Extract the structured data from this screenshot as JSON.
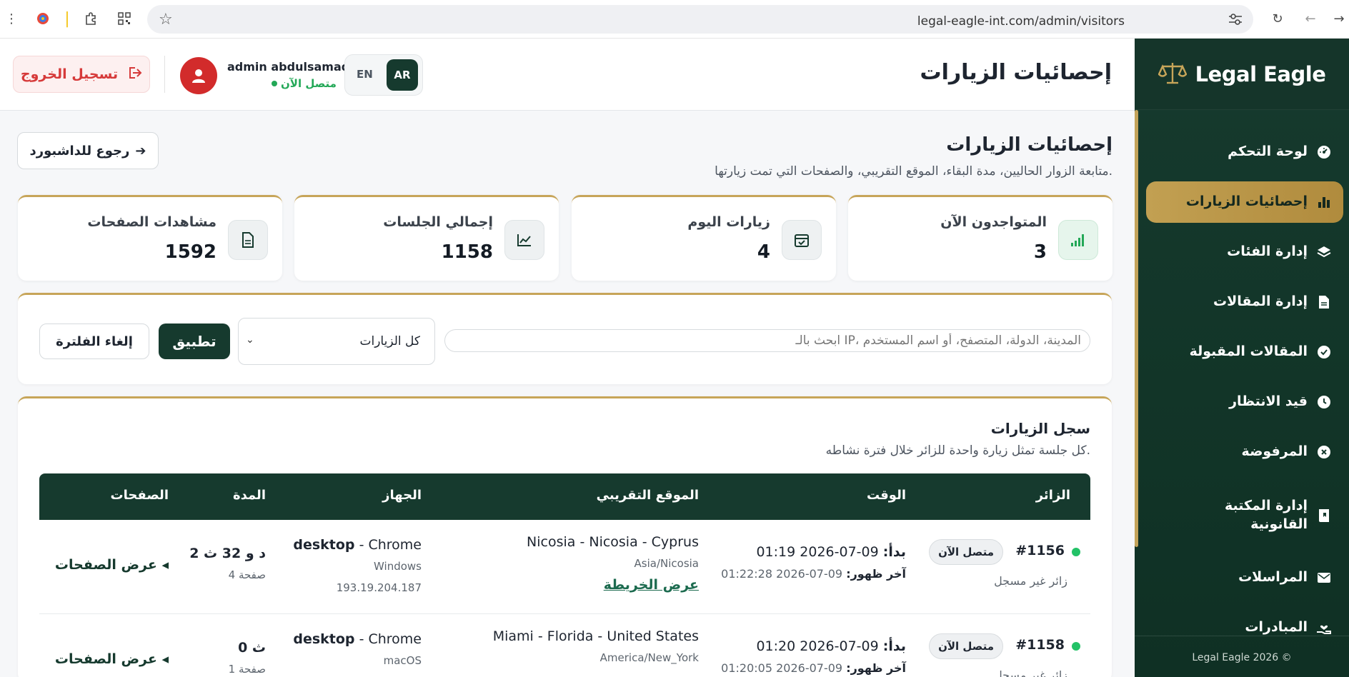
{
  "browser": {
    "url": "legal-eagle-int.com/admin/visitors"
  },
  "sidebar": {
    "brand": "Legal Eagle",
    "items": [
      {
        "label": "لوحة التحكم",
        "icon": "dashboard-gauge-icon"
      },
      {
        "label": "إحصائيات الزيارات",
        "icon": "bar-chart-icon",
        "active": true
      },
      {
        "label": "إدارة الفئات",
        "icon": "layers-icon"
      },
      {
        "label": "إدارة المقالات",
        "icon": "document-icon"
      },
      {
        "label": "المقالات المقبولة",
        "icon": "check-circle-icon"
      },
      {
        "label": "قيد الانتظار",
        "icon": "clock-icon"
      },
      {
        "label": "المرفوضة",
        "icon": "x-circle-icon"
      },
      {
        "label": "إدارة المكتبة القانونية",
        "icon": "book-icon"
      },
      {
        "label": "المراسلات",
        "icon": "envelope-icon"
      },
      {
        "label": "المبادرات",
        "icon": "hand-heart-icon"
      }
    ],
    "footer": "Legal Eagle 2026 ©"
  },
  "topbar": {
    "title": "إحصائيات الزيارات",
    "logout_label": "تسجيل الخروج",
    "admin_name": "admin abdulsamad",
    "admin_status": "متصل الآن",
    "lang_ar": "AR",
    "lang_en": "EN"
  },
  "header": {
    "title": "إحصائيات الزيارات",
    "subtitle": "متابعة الزوار الحاليين، مدة البقاء، الموقع التقريبي، والصفحات التي تمت زيارتها.",
    "back_label": "رجوع للداشبورد"
  },
  "stats": [
    {
      "label": "المتواجدون الآن",
      "value": "3",
      "icon": "signal-bars-icon"
    },
    {
      "label": "زيارات اليوم",
      "value": "4",
      "icon": "calendar-check-icon"
    },
    {
      "label": "إجمالي الجلسات",
      "value": "1158",
      "icon": "line-chart-icon"
    },
    {
      "label": "مشاهدات الصفحات",
      "value": "1592",
      "icon": "file-lines-icon"
    }
  ],
  "filters": {
    "search_placeholder": "ابحث بالـ IP، المدينة، الدولة، المتصفح، أو اسم المستخدم",
    "select_value": "كل الزيارات",
    "apply_label": "تطبيق",
    "clear_label": "إلغاء الفلترة"
  },
  "log": {
    "title": "سجل الزيارات",
    "subtitle": "كل جلسة تمثل زيارة واحدة للزائر خلال فترة نشاطه.",
    "columns": [
      "الزائر",
      "الوقت",
      "الموقع التقريبي",
      "الجهاز",
      "المدة",
      "الصفحات"
    ],
    "rows": [
      {
        "id": "#1156",
        "badge": "متصل الآن",
        "visitor_type": "زائر غير مسجل",
        "start_label": "بدأ:",
        "start_time": "09-07-2026 01:19",
        "last_label": "آخر ظهور:",
        "last_time": "09-07-2026 01:22:28",
        "location": "Nicosia - Nicosia - Cyprus",
        "timezone": "Asia/Nicosia",
        "map_label": "عرض الخريطة",
        "device_type": "desktop",
        "browser": "- Chrome",
        "os": "Windows",
        "ip": "193.19.204.187",
        "duration": "2 د و 32 ث",
        "pages_count": "4 صفحة",
        "pages_label": "عرض الصفحات ◂"
      },
      {
        "id": "#1158",
        "badge": "متصل الآن",
        "visitor_type": "زائر غير مسجل",
        "start_label": "بدأ:",
        "start_time": "09-07-2026 01:20",
        "last_label": "آخر ظهور:",
        "last_time": "09-07-2026 01:20:05",
        "location": "Miami - Florida - United States",
        "timezone": "America/New_York",
        "map_label": "",
        "device_type": "desktop",
        "browser": "- Chrome",
        "os": "macOS",
        "ip": "",
        "duration": "0 ث",
        "pages_count": "1 صفحة",
        "pages_label": "عرض الصفحات ◂"
      }
    ]
  }
}
